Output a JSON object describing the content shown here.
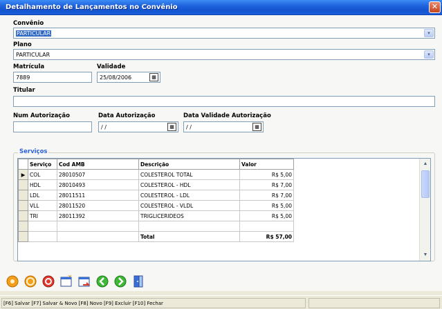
{
  "window": {
    "title": "Detalhamento de Lançamentos no Convênio",
    "close_glyph": "✕"
  },
  "form": {
    "convenio_label": "Convênio",
    "convenio_value": "PARTICULAR",
    "plano_label": "Plano",
    "plano_value": "PARTICULAR",
    "matricula_label": "Matrícula",
    "matricula_value": "7889",
    "validade_label": "Validade",
    "validade_value": "25/08/2006",
    "titular_label": "Titular",
    "titular_value": "",
    "num_autorizacao_label": "Num Autorização",
    "num_autorizacao_value": "",
    "data_autorizacao_label": "Data Autorização",
    "data_autorizacao_value": "/ /",
    "data_validade_autorizacao_label": "Data Validade Autorização",
    "data_validade_autorizacao_value": "/ /",
    "calendar_glyph": "▦",
    "dropdown_glyph": "▾"
  },
  "servicos": {
    "group_title": "Serviços",
    "columns": [
      "Serviço",
      "Cod AMB",
      "Descrição",
      "Valor"
    ],
    "rows": [
      {
        "servico": "COL",
        "cod_amb": "28010507",
        "descricao": "COLESTEROL TOTAL",
        "valor": "R$ 5,00"
      },
      {
        "servico": "HDL",
        "cod_amb": "28010493",
        "descricao": "COLESTEROL - HDL",
        "valor": "R$ 7,00"
      },
      {
        "servico": "LDL",
        "cod_amb": "28011511",
        "descricao": "COLESTEROL - LDL",
        "valor": "R$ 7,00"
      },
      {
        "servico": "VLL",
        "cod_amb": "28011520",
        "descricao": "COLESTEROL - VLDL",
        "valor": "R$ 5,00"
      },
      {
        "servico": "TRI",
        "cod_amb": "28011392",
        "descricao": "TRIGLICERIDEOS",
        "valor": "R$ 5,00"
      }
    ],
    "total_label": "Total",
    "total_value": "R$ 57,00",
    "current_row_marker": "▶"
  },
  "toolbar": {
    "icons": [
      "orange-circle-icon",
      "orange-circle-ring-icon",
      "red-target-icon",
      "new-window-icon",
      "window-arrow-icon",
      "green-left-arrow-icon",
      "green-right-arrow-icon",
      "exit-door-icon"
    ]
  },
  "statusbar": {
    "text": "[F6] Salvar [F7] Salvar & Novo [F8] Novo [F9] Excluir [F10] Fechar"
  },
  "colors": {
    "title_bar": "#1f63dd",
    "section_title": "#2a63d4",
    "selection": "#316ac5"
  }
}
